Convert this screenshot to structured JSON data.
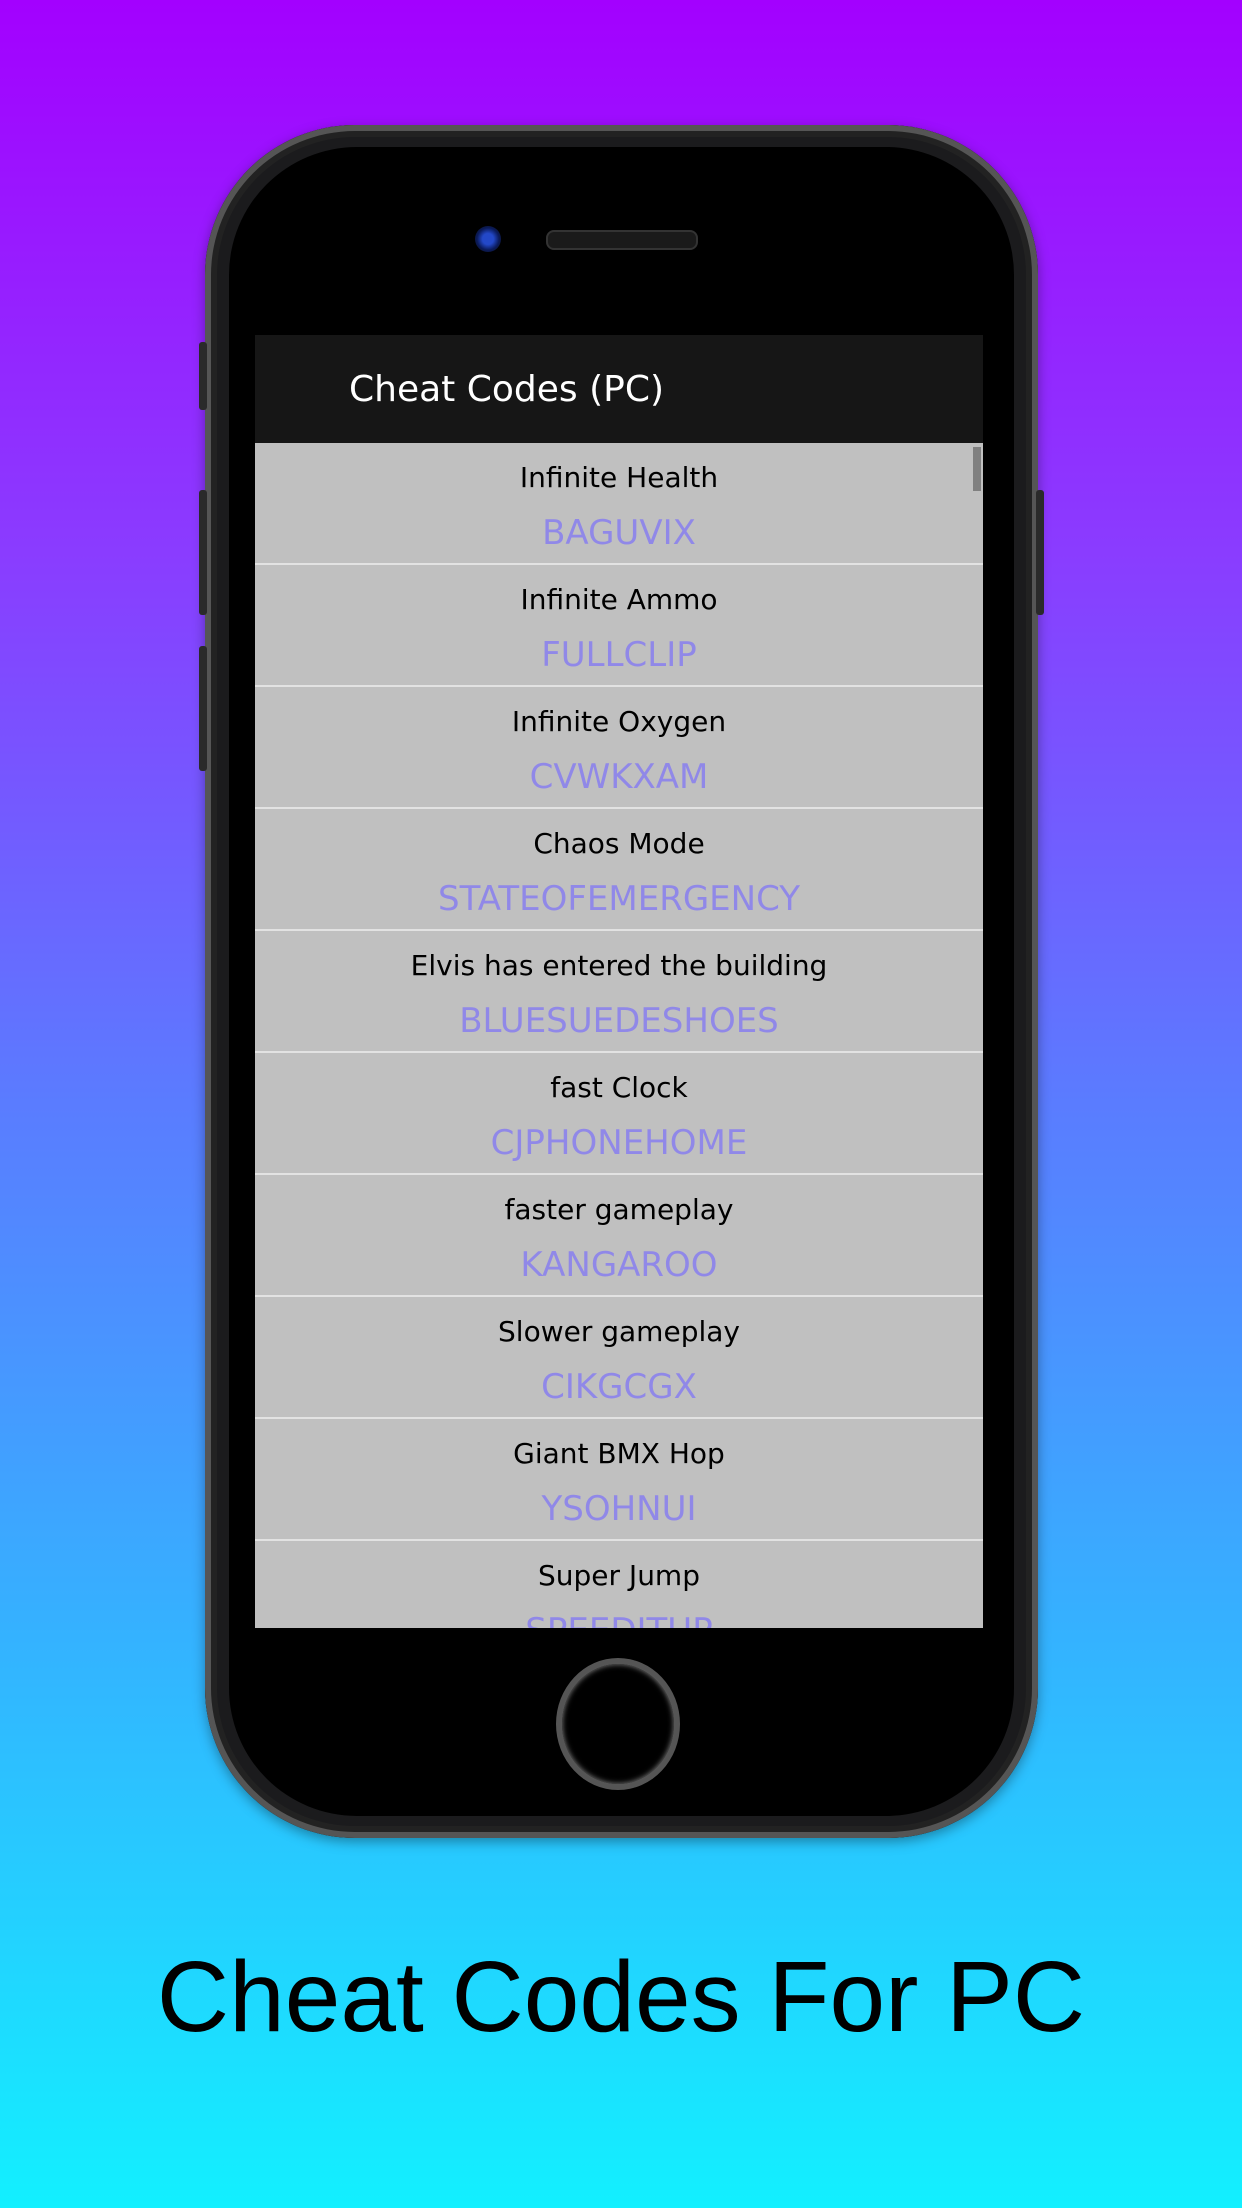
{
  "app": {
    "title": "Cheat Codes (PC)"
  },
  "cheats": [
    {
      "name": "Infinite Health",
      "code": "BAGUVIX"
    },
    {
      "name": "Infinite Ammo",
      "code": "FULLCLIP"
    },
    {
      "name": "Infinite Oxygen",
      "code": "CVWKXAM"
    },
    {
      "name": "Chaos Mode",
      "code": "STATEOFEMERGENCY"
    },
    {
      "name": "Elvis has entered the building",
      "code": "BLUESUEDESHOES"
    },
    {
      "name": "fast Clock",
      "code": "CJPHONEHOME"
    },
    {
      "name": "faster gameplay",
      "code": "KANGAROO"
    },
    {
      "name": "Slower gameplay",
      "code": "CIKGCGX"
    },
    {
      "name": "Giant BMX Hop",
      "code": "YSOHNUI"
    },
    {
      "name": "Super Jump",
      "code": "SPEEDITUP"
    }
  ],
  "caption": "Cheat Codes For PC",
  "colors": {
    "code_text": "#9088e8",
    "list_bg": "#c0c0c0",
    "appbar_bg": "#161616",
    "gradient_top": "#a300ff",
    "gradient_bottom": "#12f0ff"
  }
}
